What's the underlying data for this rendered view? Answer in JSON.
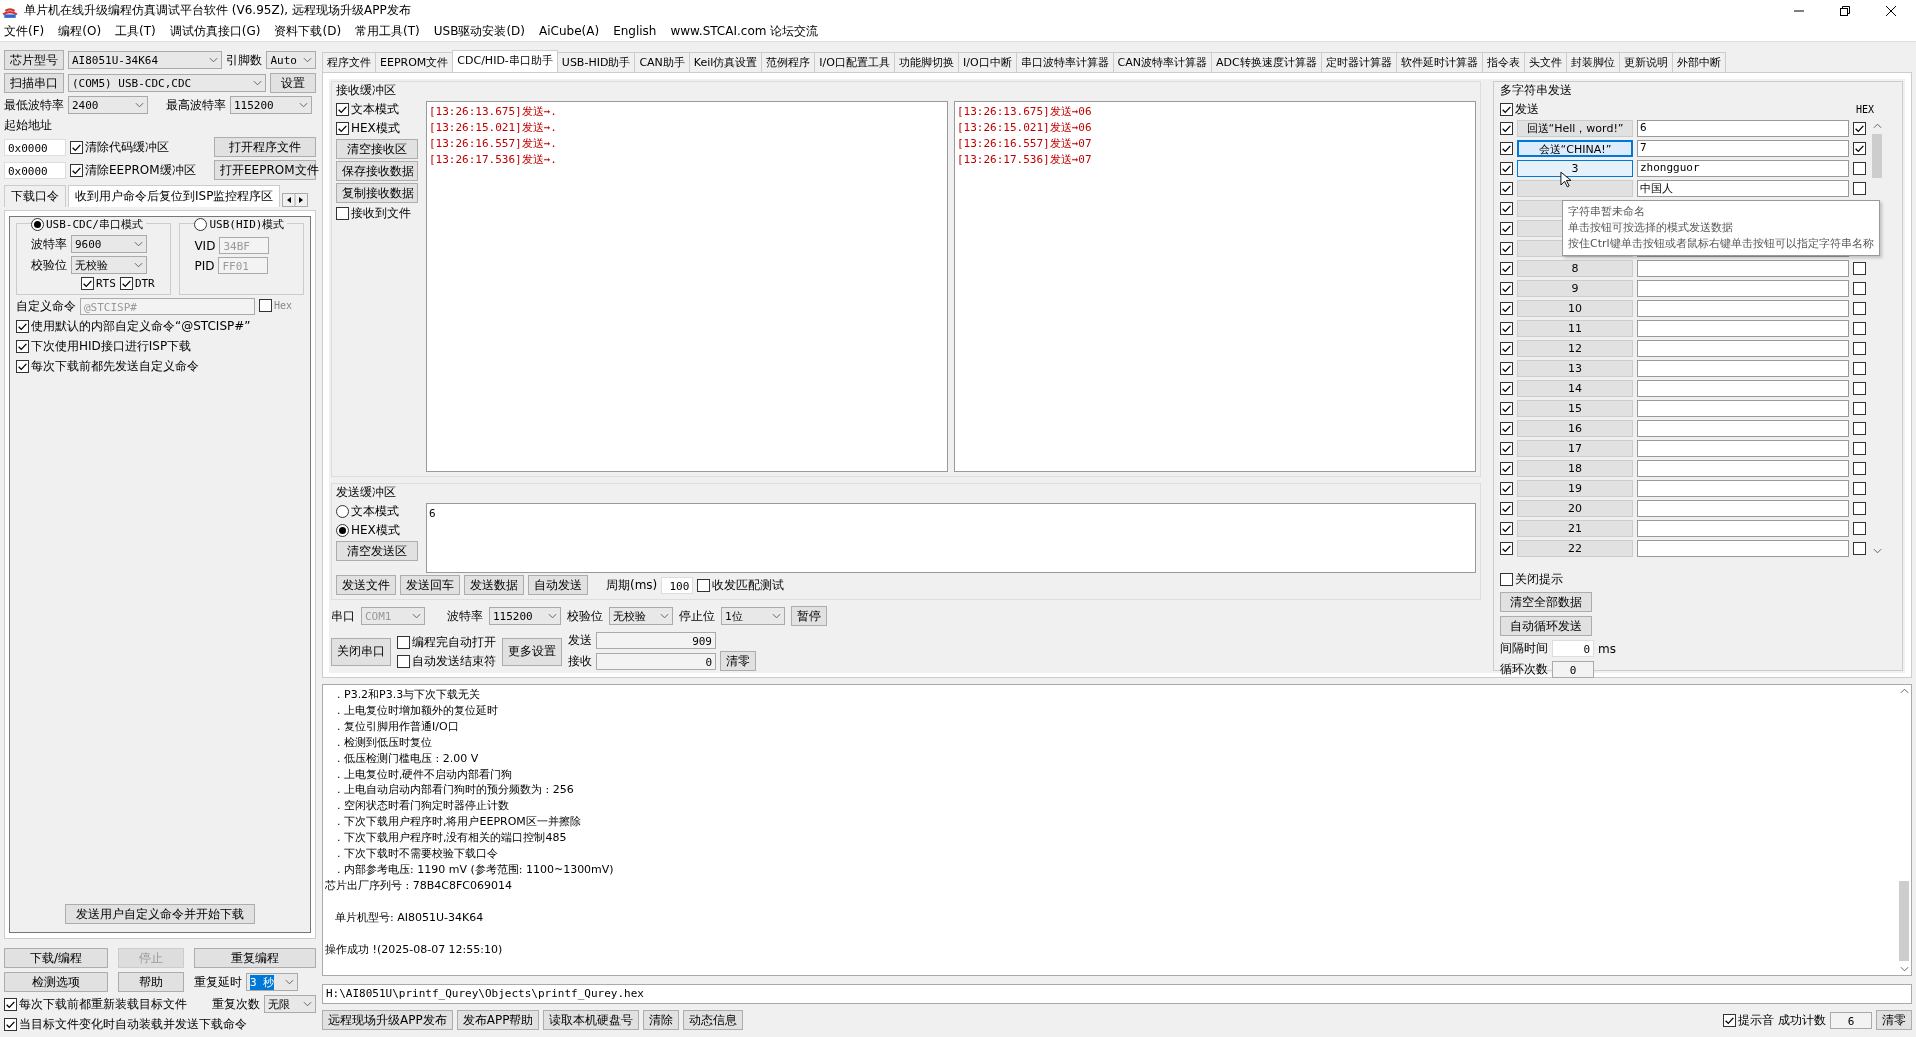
{
  "window": {
    "title": "单片机在线升级编程仿真调试平台软件 (V6.95Z), 远程现场升级APP发布"
  },
  "menu": [
    "文件(F)",
    "编程(O)",
    "工具(T)",
    "调试仿真接口(G)",
    "资料下载(D)",
    "常用工具(T)",
    "USB驱动安装(D)",
    "AiCube(A)",
    "English",
    "www.STCAI.com 论坛交流"
  ],
  "left_panel": {
    "chip_button": "芯片型号",
    "chip": "AI8051U-34K64",
    "pins_label": "引脚数",
    "pins": "Auto",
    "scan_button": "扫描串口",
    "port": "(COM5) USB-CDC,CDC",
    "settings_button": "设置",
    "min_baud_label": "最低波特率",
    "min_baud": "2400",
    "max_baud_label": "最高波特率",
    "max_baud": "115200",
    "start_address_label": "起始地址",
    "address_rows": [
      {
        "address": "0x0000",
        "label": "清除代码缓冲区",
        "checked": true,
        "button": "打开程序文件"
      },
      {
        "address": "0x0000",
        "label": "清除EEPROM缓冲区",
        "checked": true,
        "button": "打开EEPROM文件"
      }
    ],
    "tabs": [
      {
        "label": "下载口令",
        "selected": false
      },
      {
        "label": "收到用户命令后复位到ISP监控程序区",
        "selected": true
      }
    ],
    "modes": [
      {
        "label": "USB-CDC/串口模式",
        "selected": true
      },
      {
        "label": "USB(HID)模式",
        "selected": false
      }
    ],
    "baud_label": "波特率",
    "baud": "9600",
    "parity_label": "校验位",
    "parity": "无校验",
    "lines": [
      {
        "label": "RTS",
        "checked": true
      },
      {
        "label": "DTR",
        "checked": true
      }
    ],
    "vid_label": "VID",
    "vid": "34BF",
    "pid_label": "PID",
    "pid": "FF01",
    "custom_command_label": "自定义命令",
    "custom_command": "@STCISP#",
    "hex": {
      "label": "Hex",
      "checked": false
    },
    "options": [
      {
        "label": "使用默认的内部自定义命令“@STCISP#”",
        "checked": true
      },
      {
        "label": "下次使用HID接口进行ISP下载",
        "checked": true
      },
      {
        "label": "每次下载前都先发送自定义命令",
        "checked": true
      }
    ],
    "send_custom_button": "发送用户自定义命令并开始下载",
    "actions": [
      {
        "label": "下载/编程",
        "disabled": false
      },
      {
        "label": "停止",
        "disabled": true
      },
      {
        "label": "重复编程",
        "disabled": false
      },
      {
        "label": "检测选项",
        "disabled": false
      },
      {
        "label": "帮助",
        "disabled": false
      }
    ],
    "repeat_delay_label": "重复延时",
    "repeat_delay": "3 秒",
    "repeat_count_label": "重复次数",
    "repeat_count": "无限",
    "reload_options": [
      {
        "label": "每次下载前都重新装载目标文件",
        "checked": true
      },
      {
        "label": "当目标文件变化时自动装载并发送下载命令",
        "checked": true
      }
    ]
  },
  "tabs": [
    {
      "label": "程序文件",
      "selected": false
    },
    {
      "label": "EEPROM文件",
      "selected": false
    },
    {
      "label": "CDC/HID-串口助手",
      "selected": true
    },
    {
      "label": "USB-HID助手",
      "selected": false
    },
    {
      "label": "CAN助手",
      "selected": false
    },
    {
      "label": "Keil仿真设置",
      "selected": false
    },
    {
      "label": "范例程序",
      "selected": false
    },
    {
      "label": "I/O口配置工具",
      "selected": false
    },
    {
      "label": "功能脚切换",
      "selected": false
    },
    {
      "label": "I/O口中断",
      "selected": false
    },
    {
      "label": "串口波特率计算器",
      "selected": false
    },
    {
      "label": "CAN波特率计算器",
      "selected": false
    },
    {
      "label": "ADC转换速度计算器",
      "selected": false
    },
    {
      "label": "定时器计算器",
      "selected": false
    },
    {
      "label": "软件延时计算器",
      "selected": false
    },
    {
      "label": "指令表",
      "selected": false
    },
    {
      "label": "头文件",
      "selected": false
    },
    {
      "label": "封装脚位",
      "selected": false
    },
    {
      "label": "更新说明",
      "selected": false
    },
    {
      "label": "外部中断",
      "selected": false
    }
  ],
  "receive": {
    "title": "接收缓冲区",
    "options": [
      {
        "label": "文本模式",
        "checked": true
      },
      {
        "label": "HEX模式",
        "checked": true
      }
    ],
    "buttons": [
      "清空接收区",
      "保存接收数据",
      "复制接收数据"
    ],
    "to_file": {
      "label": "接收到文件",
      "checked": false
    },
    "text_lines": [
      "[13:26:13.675]发送→.",
      "[13:26:15.021]发送→.",
      "[13:26:16.557]发送→.",
      "[13:26:17.536]发送→."
    ],
    "hex_lines": [
      "[13:26:13.675]发送→06",
      "[13:26:15.021]发送→06",
      "[13:26:16.557]发送→07",
      "[13:26:17.536]发送→07"
    ]
  },
  "send": {
    "title": "发送缓冲区",
    "modes": [
      {
        "label": "文本模式",
        "selected": false
      },
      {
        "label": "HEX模式",
        "selected": true
      }
    ],
    "clear_button": "清空发送区",
    "value": "6",
    "buttons": [
      "发送文件",
      "发送回车",
      "发送数据",
      "自动发送"
    ],
    "period_label": "周期(ms)",
    "period": "100",
    "match_test": {
      "label": "收发匹配测试",
      "checked": false
    }
  },
  "serial": {
    "port_label": "串口",
    "port": "COM1",
    "baud_label": "波特率",
    "baud": "115200",
    "parity_label": "校验位",
    "parity": "无校验",
    "stop_label": "停止位",
    "stop": "1位",
    "pause_button": "暂停",
    "close_button": "关闭串口",
    "auto_open": {
      "label": "编程完自动打开",
      "checked": false
    },
    "auto_end": {
      "label": "自动发送结束符",
      "checked": false
    },
    "more_button": "更多设置",
    "sent_label": "发送",
    "sent": "909",
    "received_label": "接收",
    "received": "0",
    "clear_button": "清零"
  },
  "multi_send": {
    "title": "多字符串发送",
    "send_all": {
      "label": "发送",
      "checked": true
    },
    "hex_header": "HEX",
    "rows": [
      {
        "label": "回送“Hell，word!”",
        "value": "6",
        "send": true,
        "hex": true,
        "selected": false,
        "hovered": false
      },
      {
        "label": "会送“CHINA!”",
        "value": "7",
        "send": true,
        "hex": true,
        "selected": true,
        "hovered": false
      },
      {
        "label": "3",
        "value": "zhongguor",
        "send": true,
        "hex": false,
        "selected": false,
        "hovered": true
      },
      {
        "value": "中国人",
        "send": true,
        "hex": false,
        "selected": false,
        "hovered": false
      },
      {
        "send": true,
        "selected": false,
        "hovered": false
      },
      {
        "send": true,
        "selected": false,
        "hovered": false
      },
      {
        "send": true,
        "selected": false,
        "hovered": false
      },
      {
        "label": "8",
        "send": true,
        "hex": false,
        "selected": false,
        "hovered": false
      },
      {
        "label": "9",
        "send": true,
        "hex": false,
        "selected": false,
        "hovered": false
      },
      {
        "label": "10",
        "send": true,
        "hex": false,
        "selected": false,
        "hovered": false
      },
      {
        "label": "11",
        "send": true,
        "hex": false,
        "selected": false,
        "hovered": false
      },
      {
        "label": "12",
        "send": true,
        "hex": false,
        "selected": false,
        "hovered": false
      },
      {
        "label": "13",
        "send": true,
        "hex": false,
        "selected": false,
        "hovered": false
      },
      {
        "label": "14",
        "send": true,
        "hex": false,
        "selected": false,
        "hovered": false
      },
      {
        "label": "15",
        "send": true,
        "hex": false,
        "selected": false,
        "hovered": false
      },
      {
        "label": "16",
        "send": true,
        "hex": false,
        "selected": false,
        "hovered": false
      },
      {
        "label": "17",
        "send": true,
        "hex": false,
        "selected": false,
        "hovered": false
      },
      {
        "label": "18",
        "send": true,
        "hex": false,
        "selected": false,
        "hovered": false
      },
      {
        "label": "19",
        "send": true,
        "hex": false,
        "selected": false,
        "hovered": false
      },
      {
        "label": "20",
        "send": true,
        "hex": false,
        "selected": false,
        "hovered": false
      },
      {
        "label": "21",
        "send": true,
        "hex": false,
        "selected": false,
        "hovered": false
      },
      {
        "label": "22",
        "send": true,
        "hex": false,
        "selected": false,
        "hovered": false
      }
    ],
    "tooltip": [
      "字符串暂未命名",
      "单击按钮可按选择的模式发送数据",
      "按住Ctrl键单击按钮或者鼠标右键单击按钮可以指定字符串名称"
    ],
    "close_tips": {
      "label": "关闭提示",
      "checked": false
    },
    "clear_button": "清空全部数据",
    "auto_loop_button": "自动循环发送",
    "interval_label": "间隔时间",
    "interval": "0",
    "interval_unit": "ms",
    "loop_label": "循环次数",
    "loop": "0"
  },
  "log": [
    {
      "kind": "item",
      "text": ". P3.2和P3.3与下次下载无关"
    },
    {
      "kind": "item",
      "text": ". 上电复位时增加额外的复位延时"
    },
    {
      "kind": "item",
      "text": ". 复位引脚用作普通I/O口"
    },
    {
      "kind": "item",
      "text": ". 检测到低压时复位"
    },
    {
      "kind": "item",
      "text": ". 低压检测门槛电压 : 2.00 V"
    },
    {
      "kind": "item",
      "text": ". 上电复位时,硬件不启动内部看门狗"
    },
    {
      "kind": "item",
      "text": ". 上电自动启动内部看门狗时的预分频数为 : 256"
    },
    {
      "kind": "item",
      "text": ". 空闲状态时看门狗定时器停止计数"
    },
    {
      "kind": "item",
      "text": ". 下次下载用户程序时,将用户EEPROM区一并擦除"
    },
    {
      "kind": "item",
      "text": ". 下次下载用户程序时,没有相关的端口控制485"
    },
    {
      "kind": "item",
      "text": ". 下次下载时不需要校验下载口令"
    },
    {
      "kind": "item",
      "text": ". 内部参考电压: 1190 mV (参考范围: 1100~1300mV)"
    },
    {
      "kind": "plain",
      "text": "芯片出厂序列号 : 78B4C8FC069014"
    },
    {
      "kind": "gap"
    },
    {
      "kind": "sub",
      "text": "单片机型号: AI8051U-34K64"
    },
    {
      "kind": "gap"
    },
    {
      "kind": "plain",
      "text": "操作成功 !(2025-08-07 12:55:10)"
    }
  ],
  "path": "H:\\AI8051U\\printf_Qurey\\Objects\\printf_Qurey.hex",
  "bottom_buttons": [
    "远程现场升级APP发布",
    "发布APP帮助",
    "读取本机硬盘号",
    "清除",
    "动态信息"
  ],
  "beep": {
    "label": "提示音",
    "checked": true
  },
  "success_label": "成功计数",
  "success_count": "6",
  "reset_button": "清零"
}
